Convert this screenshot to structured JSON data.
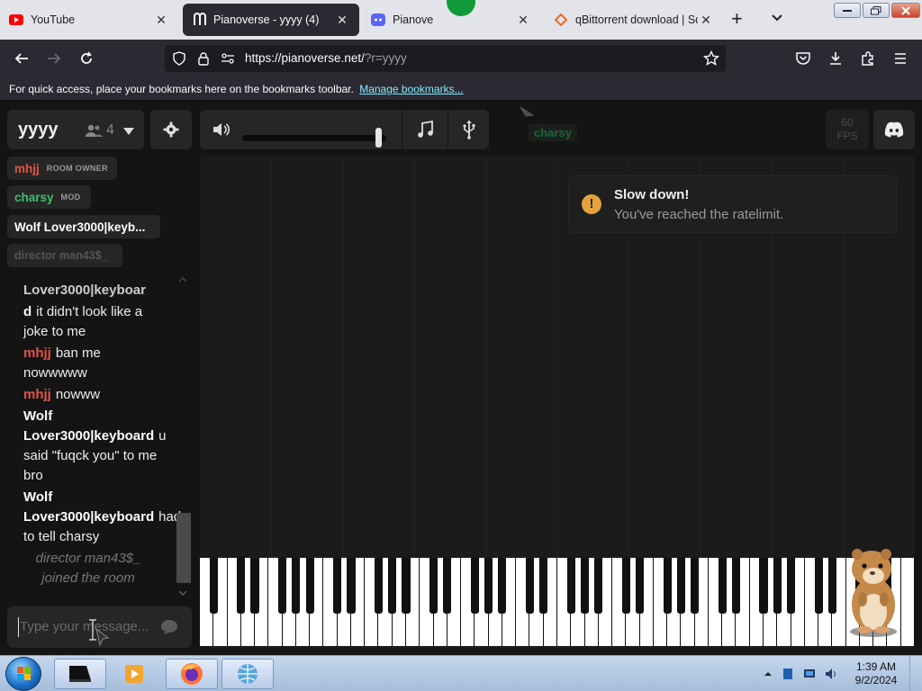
{
  "browser": {
    "tabs": [
      {
        "title": "YouTube",
        "icon": "youtube-icon",
        "close": "✕"
      },
      {
        "title": "Pianoverse - yyyy (4)",
        "icon": "pianoverse-icon",
        "close": "✕"
      },
      {
        "title": "Pianove",
        "icon": "discord-icon",
        "close": "✕"
      },
      {
        "title": "qBittorrent download | Sou",
        "icon": "sourceforge-icon",
        "close": "✕"
      }
    ],
    "new_tab": "+",
    "url_host": "https://pianoverse.net/",
    "url_rest": "?r=yyyy",
    "bookmarks_text": "For quick access, place your bookmarks here on the bookmarks toolbar.",
    "bookmarks_link": "Manage bookmarks..."
  },
  "room": {
    "name": "yyyy",
    "user_count": "4",
    "charsy_cursor_label": "charsy",
    "fps_value": "60",
    "fps_label": "FPS",
    "volume_level": 0.97
  },
  "users": [
    {
      "name": "mhjj",
      "tag": "ROOM OWNER",
      "color": "#e0554b"
    },
    {
      "name": "charsy",
      "tag": "MOD",
      "color": "#3fbf6a"
    },
    {
      "name": "Wolf Lover3000|keyb...",
      "tag": "",
      "color": "#ffffff"
    },
    {
      "name": "director man43$_",
      "tag": "",
      "color": "#555555"
    }
  ],
  "chat": [
    {
      "name": "Lover3000|keyboar",
      "name_color": "#cccccc",
      "text": ""
    },
    {
      "name": "d",
      "name_color": "#ffffff",
      "text": "it didn't look like a joke to me"
    },
    {
      "name": "mhjj",
      "name_color": "#e0554b",
      "text": "ban me nowwwww"
    },
    {
      "name": "mhjj",
      "name_color": "#e0554b",
      "text": "nowww"
    },
    {
      "name": "Wolf Lover3000|keyboard",
      "name_color": "#ffffff",
      "text": "u said \"fuqck you\" to me bro"
    },
    {
      "name": "Wolf Lover3000|keyboard",
      "name_color": "#ffffff",
      "text": "had to tell charsy"
    }
  ],
  "system_message": "director man43$_ joined the room",
  "chat_placeholder": "Type your message...",
  "toast": {
    "title": "Slow down!",
    "message": "You've reached the ratelimit.",
    "icon": "!"
  },
  "taskbar": {
    "time": "1:39 AM",
    "date": "9/2/2024"
  },
  "colors": {
    "accent_link": "#80ebff",
    "owner_red": "#e0554b",
    "mod_green": "#3fbf6a",
    "warning_amber": "#e2a43b"
  }
}
